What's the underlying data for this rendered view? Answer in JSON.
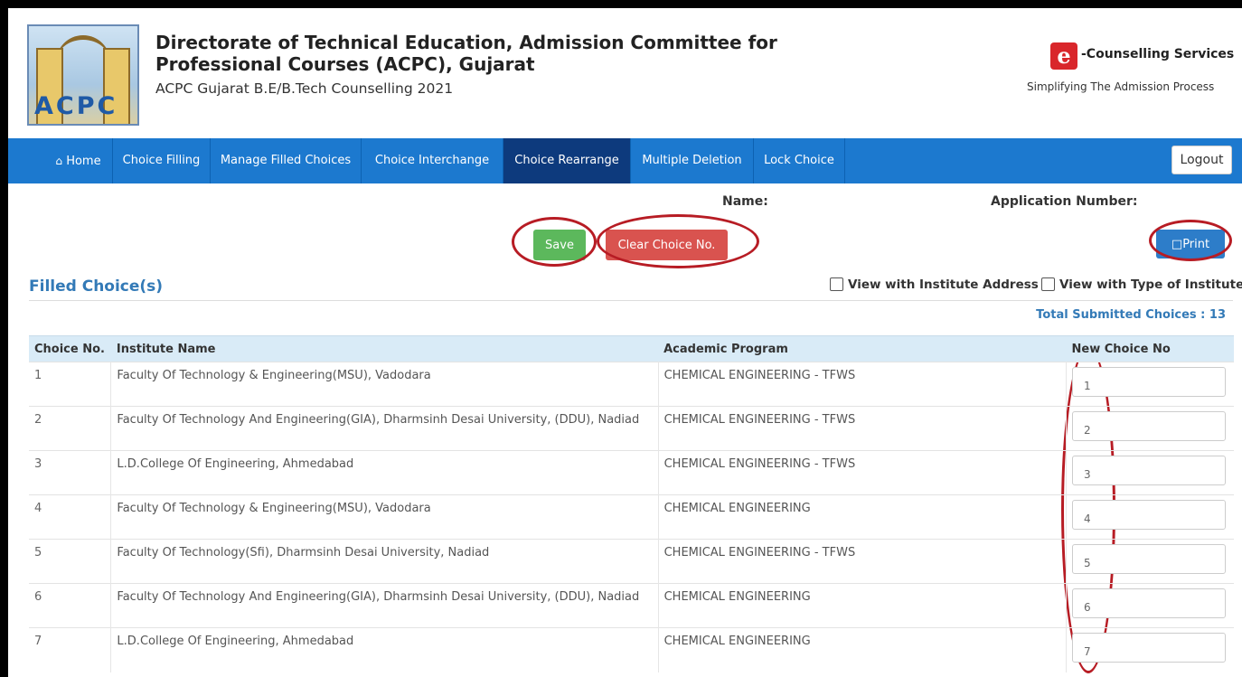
{
  "header": {
    "logo_text": "ACPC",
    "title": "Directorate of Technical Education, Admission Committee for Professional Courses (ACPC), Gujarat",
    "subtitle": "ACPC Gujarat B.E/B.Tech Counselling 2021",
    "ecounselling": {
      "mark": "e",
      "name": "-Counselling Services",
      "tagline": "Simplifying The Admission Process"
    }
  },
  "nav": {
    "items": [
      {
        "label": "Home",
        "icon": "home-icon",
        "active": false
      },
      {
        "label": "Choice Filling",
        "active": false
      },
      {
        "label": "Manage Filled Choices",
        "active": false
      },
      {
        "label": "Choice Interchange",
        "active": false
      },
      {
        "label": "Choice Rearrange",
        "active": true
      },
      {
        "label": "Multiple Deletion",
        "active": false
      },
      {
        "label": "Lock Choice",
        "active": false
      }
    ],
    "logout_label": "Logout"
  },
  "info": {
    "name_label": "Name:",
    "application_label": "Application Number:"
  },
  "actions": {
    "save_label": "Save",
    "clear_label": "Clear Choice No.",
    "print_label": "□Print"
  },
  "filled": {
    "title": "Filled Choice(s)",
    "view_address_label": "View with Institute Address",
    "view_type_label": "View with Type of Institute",
    "total_label": "Total Submitted Choices : 13"
  },
  "table": {
    "headers": [
      "Choice No.",
      "Institute Name",
      "Academic Program",
      "New Choice No"
    ],
    "rows": [
      {
        "no": "1",
        "institute": "Faculty Of Technology & Engineering(MSU), Vadodara",
        "program": "CHEMICAL ENGINEERING - TFWS",
        "new_no": "1"
      },
      {
        "no": "2",
        "institute": "Faculty Of Technology And Engineering(GIA), Dharmsinh Desai University, (DDU), Nadiad",
        "program": "CHEMICAL ENGINEERING - TFWS",
        "new_no": "2"
      },
      {
        "no": "3",
        "institute": "L.D.College Of Engineering, Ahmedabad",
        "program": "CHEMICAL ENGINEERING - TFWS",
        "new_no": "3"
      },
      {
        "no": "4",
        "institute": "Faculty Of Technology & Engineering(MSU), Vadodara",
        "program": "CHEMICAL ENGINEERING",
        "new_no": "4"
      },
      {
        "no": "5",
        "institute": "Faculty Of Technology(Sfi), Dharmsinh Desai University, Nadiad",
        "program": "CHEMICAL ENGINEERING - TFWS",
        "new_no": "5"
      },
      {
        "no": "6",
        "institute": "Faculty Of Technology And Engineering(GIA), Dharmsinh Desai University, (DDU), Nadiad",
        "program": "CHEMICAL ENGINEERING",
        "new_no": "6"
      },
      {
        "no": "7",
        "institute": "L.D.College Of Engineering, Ahmedabad",
        "program": "CHEMICAL ENGINEERING",
        "new_no": "7"
      }
    ]
  },
  "colors": {
    "navbar": "#1c79cf",
    "nav_active": "#0d3a7d",
    "save": "#5cb85c",
    "clear": "#d9534f",
    "print": "#2d7dc9",
    "annotation": "#b71c24",
    "link": "#337ab7",
    "table_header": "#d9ebf7"
  }
}
